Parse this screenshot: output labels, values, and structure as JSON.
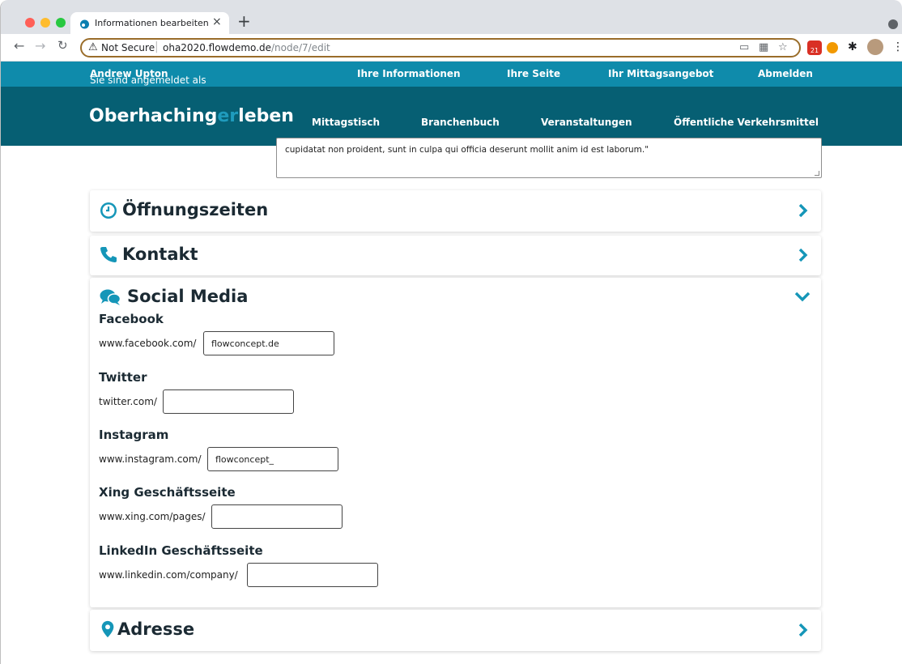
{
  "browser": {
    "tab_title": "Informationen bearbeiten flowd",
    "tab_close": "×",
    "new_tab": "+",
    "security_label": "Not Secure",
    "url_host": "oha2020.flowdemo.de",
    "url_path": "/node/7/edit",
    "ext_badge": "21"
  },
  "userbar": {
    "logged_in_prefix": "Sie sind angemeldet als",
    "user_name": "Andrew Upton",
    "links": [
      "Ihre Informationen",
      "Ihre Seite",
      "Ihr Mittagsangebot",
      "Abmelden"
    ]
  },
  "site": {
    "logo_part1": "Oberhaching",
    "logo_part2": "er",
    "logo_part3": "leben",
    "nav": [
      "Mittagstisch",
      "Branchenbuch",
      "Veranstaltungen",
      "Öffentliche Verkehrsmittel"
    ]
  },
  "description": {
    "text_tail": "cupidatat non proident, sunt in culpa qui officia deserunt mollit anim id est laborum.\""
  },
  "sections": {
    "opening_hours": "Öffnungszeiten",
    "contact": "Kontakt",
    "social_media": "Social Media",
    "address": "Adresse"
  },
  "social": {
    "facebook": {
      "label": "Facebook",
      "prefix": "www.facebook.com/",
      "value": "flowconcept.de"
    },
    "twitter": {
      "label": "Twitter",
      "prefix": "twitter.com/",
      "value": ""
    },
    "instagram": {
      "label": "Instagram",
      "prefix": "www.instagram.com/",
      "value": "flowconcept_"
    },
    "xing": {
      "label": "Xing Geschäftsseite",
      "prefix": "www.xing.com/pages/",
      "value": ""
    },
    "linkedin": {
      "label": "LinkedIn Geschäftsseite",
      "prefix": "www.linkedin.com/company/",
      "value": ""
    }
  },
  "colors": {
    "userbar": "#0f8bab",
    "mainnav": "#065f73",
    "accent": "#1596b8"
  }
}
